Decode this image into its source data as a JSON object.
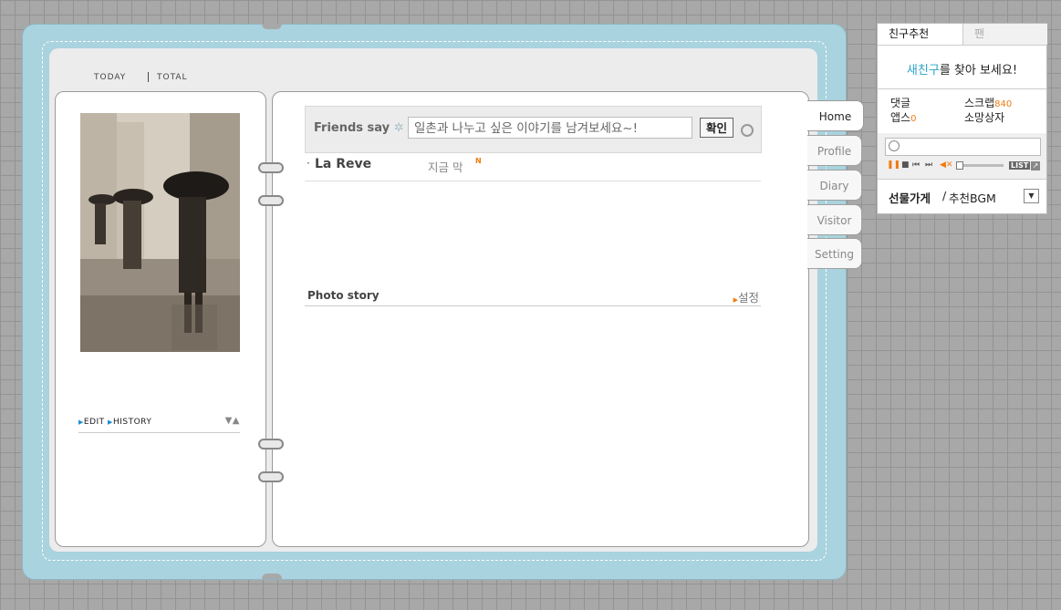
{
  "counters": {
    "today_label": "TODAY",
    "total_label": "TOTAL"
  },
  "left_page": {
    "edit_label": "EDIT",
    "history_label": "HISTORY"
  },
  "friends_say": {
    "label": "Friends say",
    "placeholder": "일촌과 나누고 싶은 이야기를 남겨보세요~!",
    "confirm_label": "확인"
  },
  "friend_entry": {
    "name": "La Reve",
    "time": "지금 막",
    "new_badge": "N"
  },
  "photo_story": {
    "title": "Photo story",
    "setting_link": "설정"
  },
  "tabs": [
    {
      "label": "Home"
    },
    {
      "label": "Profile"
    },
    {
      "label": "Diary"
    },
    {
      "label": "Visitor"
    },
    {
      "label": "Setting"
    }
  ],
  "widget": {
    "tab_recommend": "친구추천",
    "tab_fan": "팬",
    "find_highlight": "새친구",
    "find_rest": "를 찾아 보세요!",
    "stats": {
      "comments_label": "댓글",
      "scrap_label": "스크랩",
      "scrap_count": "840",
      "apps_label": "앱스",
      "apps_count": "0",
      "wishbox_label": "소망상자"
    },
    "player": {
      "list_label": "LIST"
    },
    "bgm": {
      "shop_label": "선물가게",
      "separator": " / ",
      "recommend_label": "추천BGM"
    }
  },
  "colors": {
    "book": "#a9d3de",
    "accent_orange": "#f07a10",
    "accent_blue": "#1e8fd8",
    "find_highlight": "#2aa3c8"
  },
  "icons": [
    "gear-icon",
    "refresh-icon",
    "new-badge-icon",
    "pause-icon",
    "stop-icon",
    "prev-icon",
    "next-icon",
    "mute-icon",
    "expand-icon",
    "dropdown-icon",
    "play-circle-icon",
    "up-down-icon"
  ]
}
